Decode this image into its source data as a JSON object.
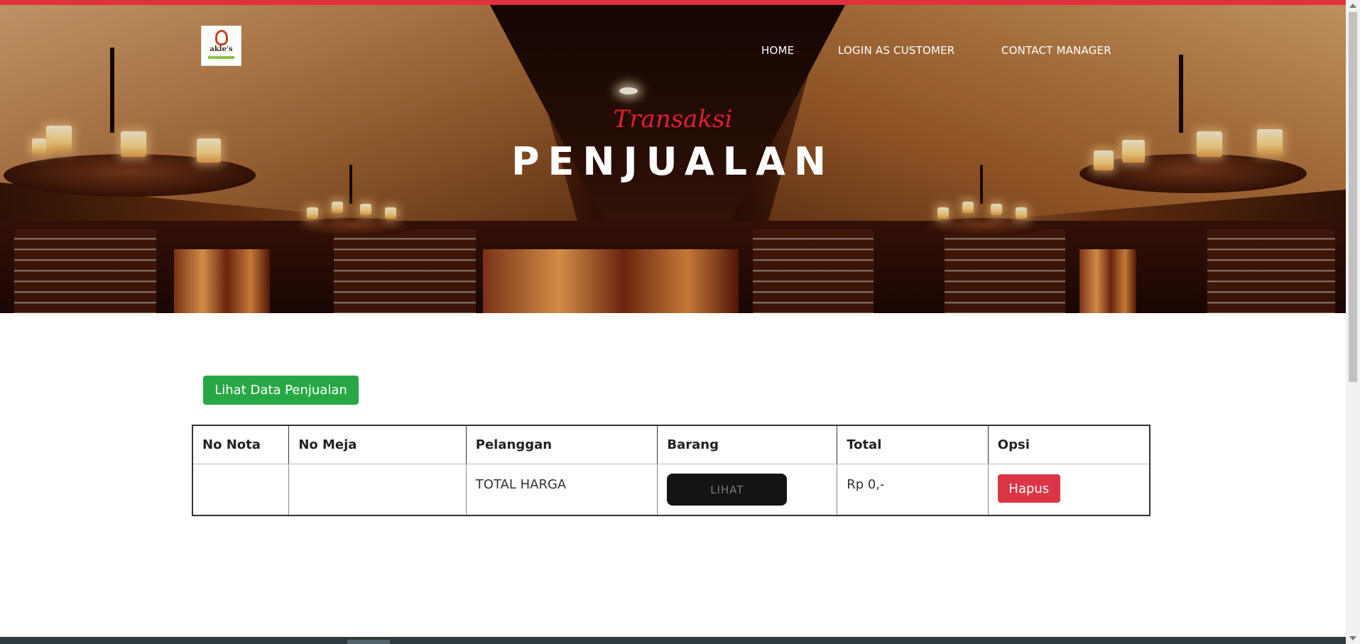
{
  "brand": {
    "logo_text": "akle's",
    "accent_color": "#e0323c"
  },
  "nav": {
    "items": [
      {
        "label": "HOME"
      },
      {
        "label": "LOGIN AS CUSTOMER"
      },
      {
        "label": "CONTACT MANAGER"
      }
    ]
  },
  "hero": {
    "subtitle": "Transaksi",
    "title": "PENJUALAN",
    "subtitle_color": "#e0202e"
  },
  "actions": {
    "view_sales_label": "Lihat Data Penjualan",
    "view_sales_color": "#28a745"
  },
  "table": {
    "headers": [
      "No Nota",
      "No Meja",
      "Pelanggan",
      "Barang",
      "Total",
      "Opsi"
    ],
    "rows": [
      {
        "no_nota": "",
        "no_meja": "",
        "pelanggan": "TOTAL HARGA",
        "barang_button": "LIHAT",
        "total": "Rp 0,-",
        "opsi_button": "Hapus"
      }
    ],
    "delete_color": "#dc3545"
  }
}
